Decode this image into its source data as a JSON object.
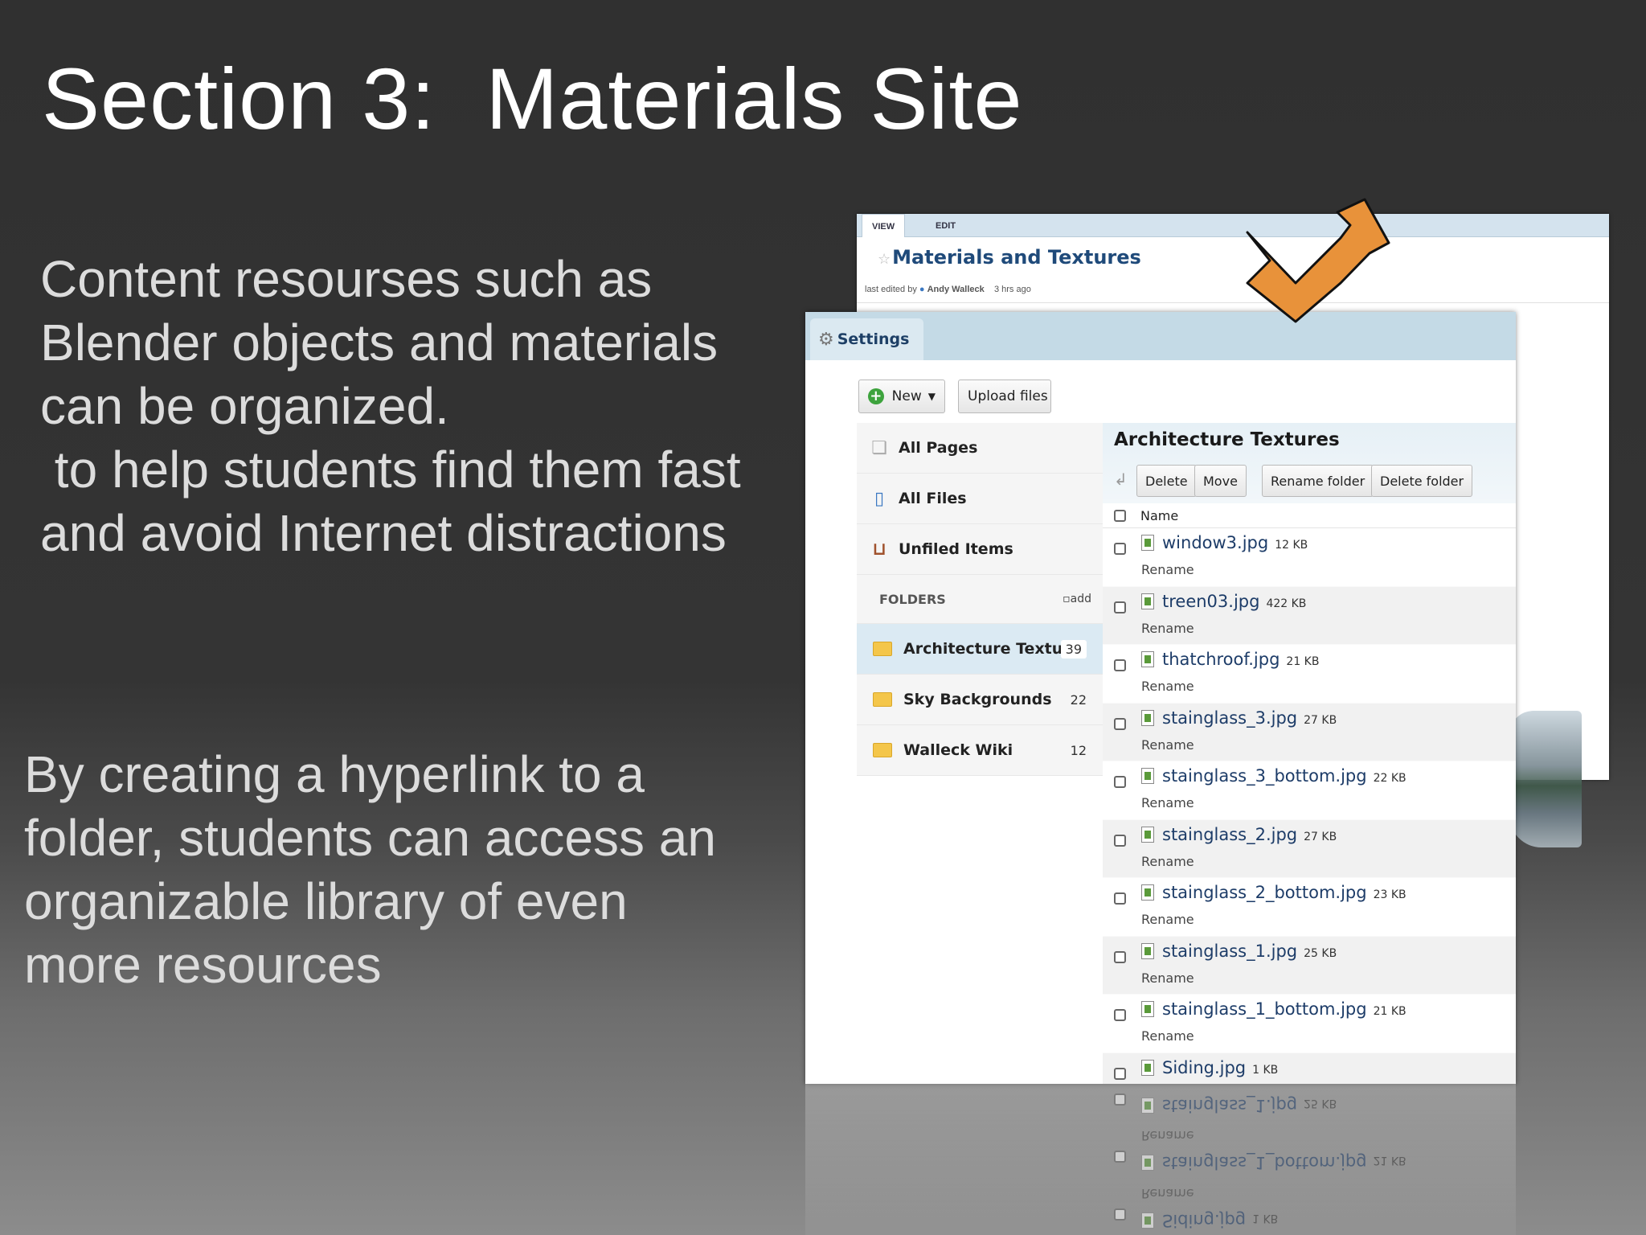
{
  "slide": {
    "title": "Section 3:  Materials Site",
    "paragraph1": "Content resourses such as Blender objects and materials can be organized.\n to help students find them fast and avoid Internet distractions",
    "paragraph2": "By creating a hyperlink to a folder, students can access an organizable library of even more resources",
    "accent_color": "#e8923a"
  },
  "wiki": {
    "tab_view": "VIEW",
    "tab_edit": "EDIT",
    "page_title": "Materials and Textures",
    "meta_prefix": "last edited by",
    "meta_user": "Andy Walleck",
    "meta_time": "3 hrs ago"
  },
  "settings": {
    "tab_label": "Settings",
    "new_button": "New",
    "upload_button": "Upload files",
    "nav": {
      "all_pages": "All Pages",
      "all_files": "All Files",
      "unfiled": "Unfiled Items"
    },
    "folders_header": "FOLDERS",
    "folders_add": "add",
    "folders": [
      {
        "name": "Architecture Textu...",
        "count": "39"
      },
      {
        "name": "Sky Backgrounds",
        "count": "22"
      },
      {
        "name": "Walleck Wiki",
        "count": "12"
      }
    ],
    "panel": {
      "title": "Architecture Textures",
      "delete": "Delete",
      "move": "Move",
      "rename_folder": "Rename folder",
      "delete_folder": "Delete folder",
      "name_column": "Name",
      "rename_label": "Rename"
    },
    "files": [
      {
        "name": "window3.jpg",
        "size": "12 KB"
      },
      {
        "name": "treen03.jpg",
        "size": "422 KB"
      },
      {
        "name": "thatchroof.jpg",
        "size": "21 KB"
      },
      {
        "name": "stainglass_3.jpg",
        "size": "27 KB"
      },
      {
        "name": "stainglass_3_bottom.jpg",
        "size": "22 KB"
      },
      {
        "name": "stainglass_2.jpg",
        "size": "27 KB"
      },
      {
        "name": "stainglass_2_bottom.jpg",
        "size": "23 KB"
      },
      {
        "name": "stainglass_1.jpg",
        "size": "25 KB"
      },
      {
        "name": "stainglass_1_bottom.jpg",
        "size": "21 KB"
      },
      {
        "name": "Siding.jpg",
        "size": "1 KB"
      }
    ]
  }
}
